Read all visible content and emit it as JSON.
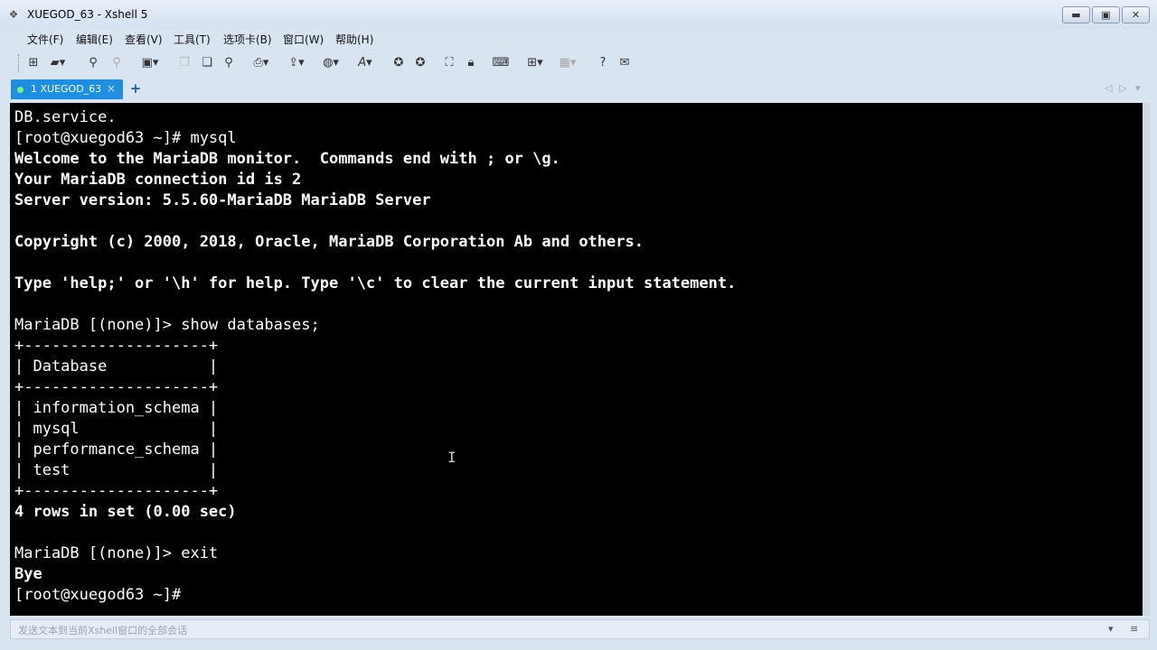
{
  "window": {
    "title": "XUEGOD_63 - Xshell 5"
  },
  "controls": {
    "minimize": "▬",
    "maximize": "▣",
    "close": "✕"
  },
  "menu": [
    "文件(F)",
    "编辑(E)",
    "查看(V)",
    "工具(T)",
    "选项卡(B)",
    "窗口(W)",
    "帮助(H)"
  ],
  "tabs": [
    {
      "label": "1 XUEGOD_63",
      "close": "×"
    }
  ],
  "tab_add": "+",
  "terminal": {
    "lines": [
      {
        "text": "DB.service.",
        "bold": false
      },
      {
        "text": "[root@xuegod63 ~]# mysql",
        "bold": false
      },
      {
        "text": "Welcome to the MariaDB monitor.  Commands end with ; or \\g.",
        "bold": true
      },
      {
        "text": "Your MariaDB connection id is 2",
        "bold": true
      },
      {
        "text": "Server version: 5.5.60-MariaDB MariaDB Server",
        "bold": true
      },
      {
        "text": "",
        "bold": false
      },
      {
        "text": "Copyright (c) 2000, 2018, Oracle, MariaDB Corporation Ab and others.",
        "bold": true
      },
      {
        "text": "",
        "bold": false
      },
      {
        "text": "Type 'help;' or '\\h' for help. Type '\\c' to clear the current input statement.",
        "bold": true
      },
      {
        "text": "",
        "bold": false
      },
      {
        "text": "MariaDB [(none)]> show databases;",
        "bold": false
      },
      {
        "text": "+--------------------+",
        "bold": false
      },
      {
        "text": "| Database           |",
        "bold": false
      },
      {
        "text": "+--------------------+",
        "bold": false
      },
      {
        "text": "| information_schema |",
        "bold": false
      },
      {
        "text": "| mysql              |",
        "bold": false
      },
      {
        "text": "| performance_schema |",
        "bold": false
      },
      {
        "text": "| test               |",
        "bold": false
      },
      {
        "text": "+--------------------+",
        "bold": false
      },
      {
        "text": "4 rows in set (0.00 sec)",
        "bold": true
      },
      {
        "text": "",
        "bold": false
      },
      {
        "text": "MariaDB [(none)]> exit",
        "bold": false
      },
      {
        "text": "Bye",
        "bold": true
      },
      {
        "text": "[root@xuegod63 ~]#",
        "bold": false
      }
    ]
  },
  "sendbar": {
    "placeholder": "发送文本到当前Xshell窗口的全部会话"
  },
  "colors": {
    "tab_active": "#1e8fe0",
    "terminal_bg": "#000000",
    "terminal_fg": "#ffffff"
  }
}
